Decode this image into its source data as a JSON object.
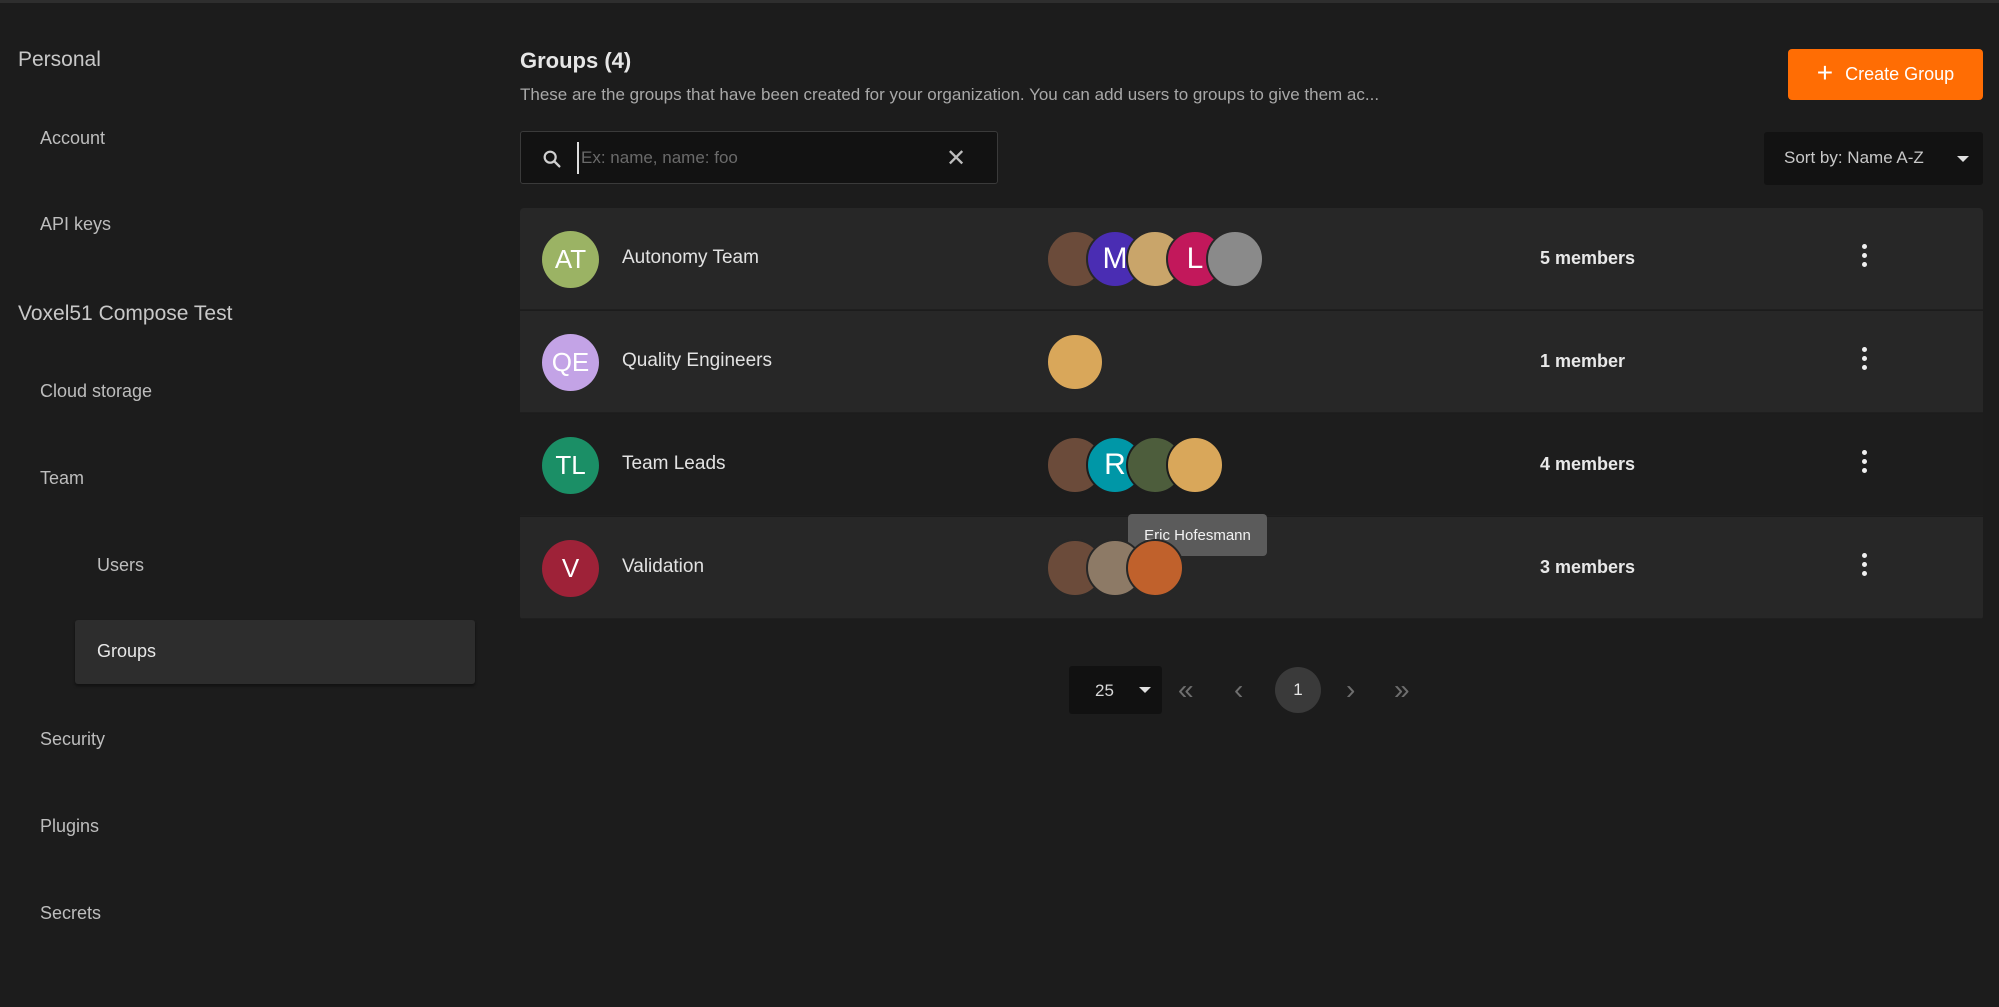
{
  "sidebar": {
    "personal_heading": "Personal",
    "account": "Account",
    "api_keys": "API keys",
    "org_heading": "Voxel51 Compose Test",
    "cloud_storage": "Cloud storage",
    "team": "Team",
    "users": "Users",
    "groups": "Groups",
    "security": "Security",
    "plugins": "Plugins",
    "secrets": "Secrets"
  },
  "header": {
    "title": "Groups (4)",
    "subtitle": "These are the groups that have been created for your organization. You can add users to groups to give them ac...",
    "create_label": "Create Group"
  },
  "search": {
    "placeholder": "Ex: name, name: foo",
    "value": ""
  },
  "sort": {
    "label": "Sort by: Name A-Z"
  },
  "groups": [
    {
      "initials": "AT",
      "name": "Autonomy Team",
      "count": "5 members",
      "color": "#9bb364",
      "members": [
        {
          "initial": "",
          "color": "#6b4b3a"
        },
        {
          "initial": "M",
          "color": "#4a2db3"
        },
        {
          "initial": "",
          "color": "#c9a56a"
        },
        {
          "initial": "L",
          "color": "#c2185b"
        },
        {
          "initial": "",
          "color": "#8a8a8a"
        }
      ]
    },
    {
      "initials": "QE",
      "name": "Quality Engineers",
      "count": "1 member",
      "color": "#c3a3e6",
      "members": [
        {
          "initial": "",
          "color": "#d9a75a"
        }
      ]
    },
    {
      "initials": "TL",
      "name": "Team Leads",
      "count": "4 members",
      "color": "#1b8f66",
      "members": [
        {
          "initial": "",
          "color": "#6b4b3a"
        },
        {
          "initial": "R",
          "color": "#0097a7"
        },
        {
          "initial": "",
          "color": "#4d5d3c"
        },
        {
          "initial": "",
          "color": "#d9a75a"
        }
      ]
    },
    {
      "initials": "V",
      "name": "Validation",
      "count": "3 members",
      "color": "#9e2238",
      "members": [
        {
          "initial": "",
          "color": "#6b4b3a"
        },
        {
          "initial": "",
          "color": "#8d7a66"
        },
        {
          "initial": "",
          "color": "#c0612c"
        }
      ]
    }
  ],
  "tooltip": "Eric Hofesmann",
  "pagination": {
    "per_page": "25",
    "current": "1"
  },
  "colors": {
    "accent": "#ff6d04",
    "background": "#1c1c1c"
  }
}
